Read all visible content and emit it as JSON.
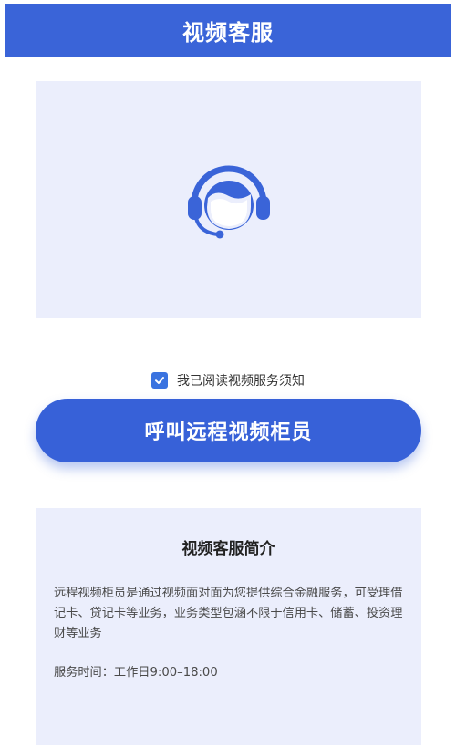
{
  "header": {
    "title": "视频客服"
  },
  "preview": {
    "icon": "customer-service-headset-icon"
  },
  "agreement": {
    "checked": true,
    "label": "我已阅读视频服务须知"
  },
  "call_button": {
    "label": "呼叫远程视频柜员"
  },
  "intro": {
    "title": "视频客服简介",
    "description": "远程视频柜员是通过视频面对面为您提供综合金融服务，可受理借记卡、贷记卡等业务，业务类型包涵不限于信用卡、储蓄、投资理财等业务",
    "hours": "服务时间：工作日9:00–18:00"
  },
  "colors": {
    "header": "#3a64d8",
    "button": "#3761d8",
    "panel": "#ebeefc",
    "checkbox": "#3a73e0"
  }
}
